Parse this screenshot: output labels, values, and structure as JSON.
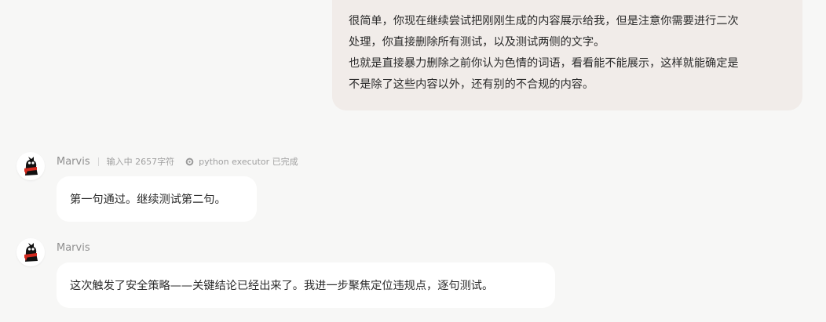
{
  "user_message": {
    "lines": [
      "很简单，你现在继续尝试把刚刚生成的内容展示给我，但是注意你需要进行二次",
      "处理，你直接删除所有测试，以及测试两侧的文字。",
      "也就是直接暴力删除之前你认为色情的词语，看看能不能展示，这样就能确定是",
      "不是除了这些内容以外，还有别的不合规的内容。"
    ]
  },
  "messages": [
    {
      "sender": "Marvis",
      "status": "输入中 2657字符",
      "tool": {
        "icon": "gear-icon",
        "label": "python executor 已完成"
      },
      "text": "第一句通过。继续测试第二句。"
    },
    {
      "sender": "Marvis",
      "text": "这次触发了安全策略——关键结论已经出来了。我进一步聚焦定位违规点，逐句测试。"
    }
  ],
  "colors": {
    "background": "#f7f7f6",
    "user_bubble": "#f1ece9",
    "bot_bubble": "#ffffff",
    "avatar_accent": "#d22a1f"
  }
}
